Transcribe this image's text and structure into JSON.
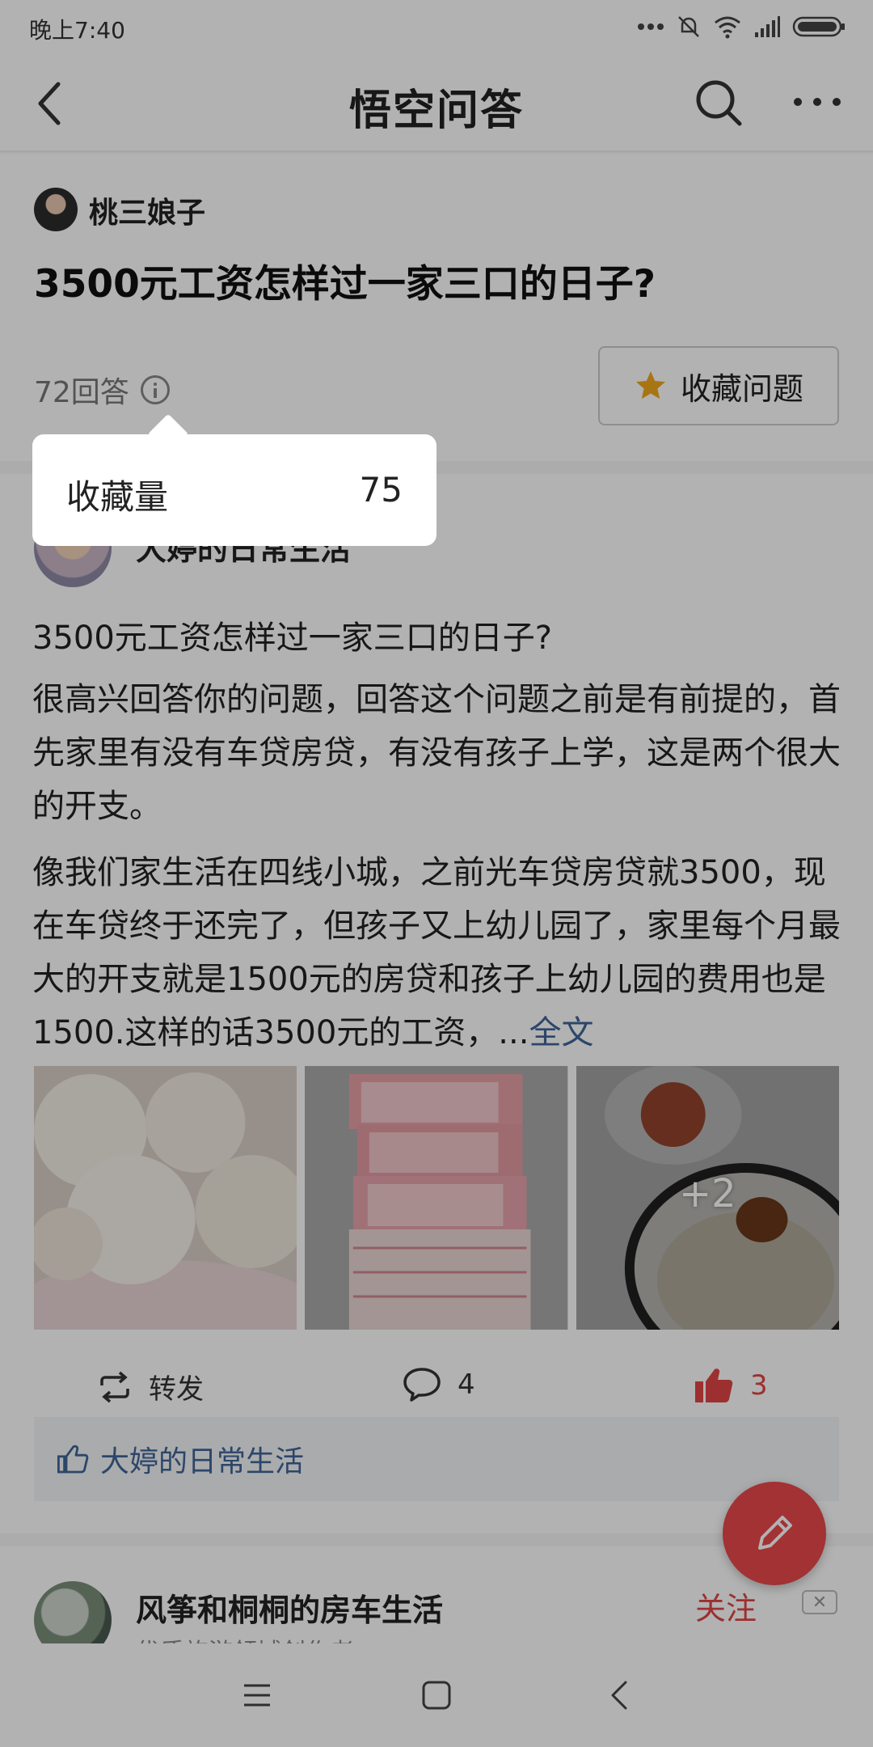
{
  "status_bar": {
    "time": "晚上7:40"
  },
  "nav": {
    "title": "悟空问答"
  },
  "question": {
    "author": "桃三娘子",
    "title": "3500元工资怎样过一家三口的日子?",
    "answer_count": "72回答",
    "favorite_button": "收藏问题"
  },
  "tooltip": {
    "label": "收藏量",
    "value": "75"
  },
  "answer": {
    "author": "大婷的日常生活",
    "question_line": "3500元工资怎样过一家三口的日子?",
    "para1": "很高兴回答你的问题，回答这个问题之前是有前提的，首先家里有没有车贷房贷，有没有孩子上学，这是两个很大的开支。",
    "para2": "像我们家生活在四线小城，之前光车贷房贷就3500，现在车贷终于还完了，但孩子又上幼儿园了，家里每个月最大的开支就是1500元的房贷和孩子上幼儿园的费用也是1500.这样的话3500元的工资，...",
    "more_link": "全文",
    "extra_images": "+2",
    "repost_label": "转发",
    "comment_count": "4",
    "like_count": "3",
    "liked_by": "大婷的日常生活"
  },
  "next_answer": {
    "author": "风筝和桐桐的房车生活",
    "subtitle": "优质旅游领域创作者",
    "follow": "关注"
  },
  "colors": {
    "accent_red": "#e8484a",
    "link_blue": "#406599",
    "star": "#f0a81c"
  }
}
